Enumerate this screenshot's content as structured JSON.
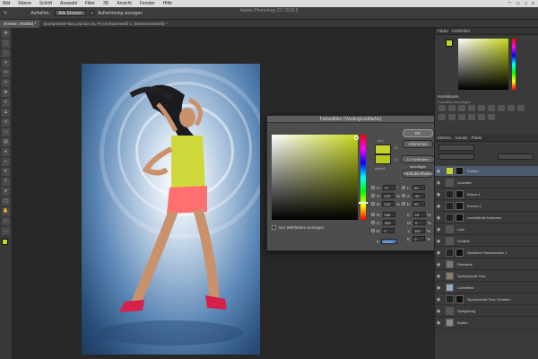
{
  "menubar": {
    "items": [
      "Bild",
      "Ebene",
      "Schrift",
      "Auswahl",
      "Filter",
      "3D",
      "Ansicht",
      "Fenster",
      "Hilfe"
    ],
    "status_icons": [
      "wifi-icon",
      "battery-icon",
      "search-icon",
      "menu-icon"
    ]
  },
  "app_title": "Adobe Photoshop CC 2015.5",
  "options_bar": {
    "sample_label": "Aufnehm.:",
    "sample_value": "Alle Ebenen",
    "sample_all_label": "Aufnehmring anzeigen"
  },
  "tabs": [
    {
      "label": "(Farben, RGB/8) *",
      "active": true
    },
    {
      "label": "Sportportrait-Tanz.psd bei 16,7% (Schwarzweiß 1, Ebenenmaske/8) *",
      "active": false
    }
  ],
  "color_picker": {
    "title": "Farbwähler (Vordergrundfarbe)",
    "label_new": "neu",
    "label_current": "aktuell",
    "ok_label": "OK",
    "cancel_label": "Abbrechen",
    "add_swatch_label": "Zu Farbfeldern hinzufügen",
    "libraries_label": "Farbbibliotheken",
    "web_only_label": "Nur Webfarben anzeigen",
    "new_color": "#c4d42a",
    "current_color": "#b8c620",
    "fields_left": [
      {
        "name": "H:",
        "value": "71",
        "unit": "°"
      },
      {
        "name": "S:",
        "value": "100",
        "unit": "%"
      },
      {
        "name": "B:",
        "value": "100",
        "unit": "%"
      },
      {
        "name": "R:",
        "value": "208",
        "unit": ""
      },
      {
        "name": "G:",
        "value": "253",
        "unit": ""
      },
      {
        "name": "B:",
        "value": "0",
        "unit": ""
      }
    ],
    "fields_right": [
      {
        "name": "L:",
        "value": "94",
        "unit": ""
      },
      {
        "name": "a:",
        "value": "-34",
        "unit": ""
      },
      {
        "name": "b:",
        "value": "93",
        "unit": ""
      },
      {
        "name": "C:",
        "value": "29",
        "unit": "%"
      },
      {
        "name": "M:",
        "value": "0",
        "unit": "%"
      },
      {
        "name": "Y:",
        "value": "100",
        "unit": "%"
      },
      {
        "name": "K:",
        "value": "0",
        "unit": "%"
      }
    ],
    "hex_label": "#",
    "hex_value": "d0fd00"
  },
  "right_panel": {
    "color_tabs": [
      "Farbe",
      "Farbfelder"
    ],
    "correction_title": "Korrekturen",
    "correction_subtitle": "Korrektur hinzufügen",
    "layers_tabs": [
      "Ebenen",
      "Kanäle",
      "Pfade"
    ],
    "layers": [
      {
        "name": "Farben",
        "has_mask": true
      },
      {
        "name": "Leuchten",
        "has_mask": false
      },
      {
        "name": "Ebene 1",
        "has_mask": true
      },
      {
        "name": "Kurven 1",
        "has_mask": true
      },
      {
        "name": "Leuchtende Konturen",
        "has_mask": true
      },
      {
        "name": "Licht",
        "has_mask": false
      },
      {
        "name": "Schärfe",
        "has_mask": false
      },
      {
        "name": "Selektive Farbkorrektur 1",
        "has_mask": true
      },
      {
        "name": "Retusche",
        "has_mask": false
      },
      {
        "name": "Sportportrait-Tanz",
        "has_mask": false
      },
      {
        "name": "Lichteffekt",
        "has_mask": false
      },
      {
        "name": "Sportportrait-Tanz Schatten",
        "has_mask": true
      },
      {
        "name": "Spiegelung",
        "has_mask": false
      },
      {
        "name": "Boden",
        "has_mask": false
      }
    ]
  }
}
